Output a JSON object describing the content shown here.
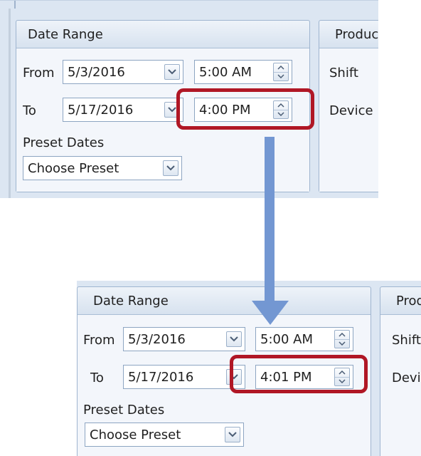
{
  "before": {
    "date_range": {
      "title": "Date Range",
      "from_label": "From",
      "from_date": "5/3/2016",
      "from_time": "5:00 AM",
      "to_label": "To",
      "to_date": "5/17/2016",
      "to_time": "4:00 PM",
      "preset_label": "Preset Dates",
      "preset_value": "Choose Preset"
    },
    "side_panel": {
      "title": "Produc",
      "shift_label": "Shift",
      "device_label": "Device"
    }
  },
  "after": {
    "date_range": {
      "title": "Date Range",
      "from_label": "From",
      "from_date": "5/3/2016",
      "from_time": "5:00 AM",
      "to_label": "To",
      "to_date": "5/17/2016",
      "to_time": "4:01 PM",
      "preset_label": "Preset Dates",
      "preset_value": "Choose Preset"
    },
    "side_panel": {
      "title": "Prod",
      "shift_label": "Shift",
      "device_label": "Devi"
    }
  },
  "colors": {
    "highlight": "#b01725",
    "arrow": "#7397d2",
    "panel_bg": "#dce6f2"
  },
  "icons": [
    "chevron-down-icon",
    "spin-up-icon",
    "spin-down-icon",
    "down-arrow-icon"
  ]
}
